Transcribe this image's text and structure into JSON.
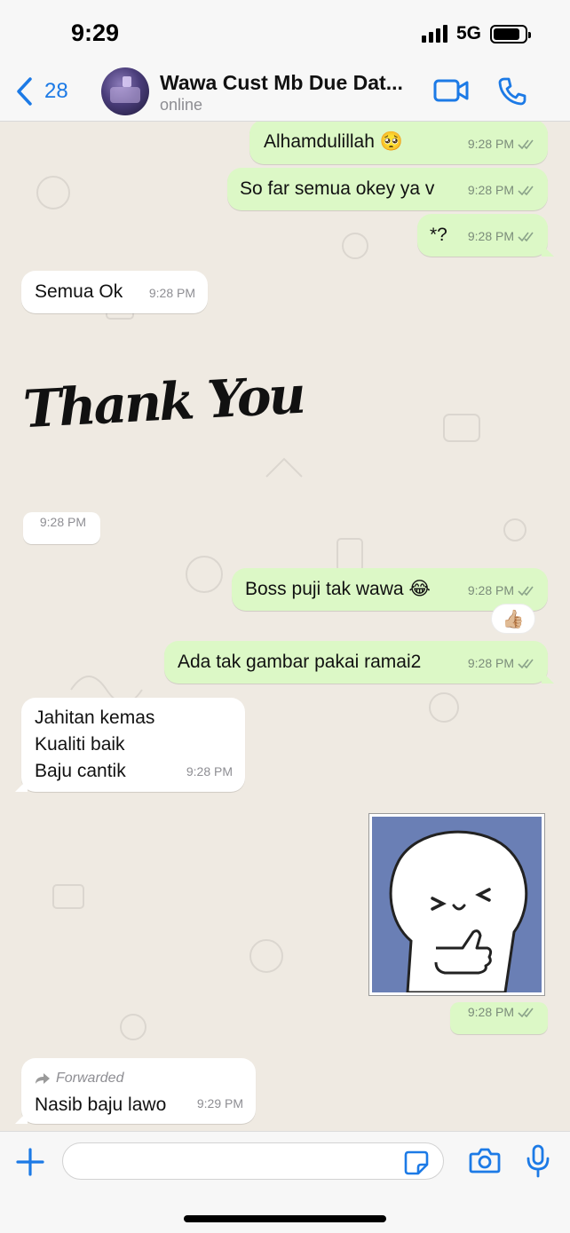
{
  "status_bar": {
    "time": "9:29",
    "network": "5G"
  },
  "header": {
    "back_count": "28",
    "contact_name": "Wawa Cust Mb Due Dat...",
    "contact_status": "online"
  },
  "messages": [
    {
      "dir": "out",
      "text": "Alhamdulillah 🥺",
      "time": "9:28 PM"
    },
    {
      "dir": "out",
      "text": "So far semua okey ya v",
      "time": "9:28 PM"
    },
    {
      "dir": "out",
      "text": "*?",
      "time": "9:28 PM"
    },
    {
      "dir": "in",
      "text": "Semua Ok",
      "time": "9:28 PM"
    },
    {
      "dir": "in",
      "type": "sticker",
      "text": "Thank You",
      "time": "9:28 PM"
    },
    {
      "dir": "out",
      "text": "Boss puji tak wawa 😂",
      "time": "9:28 PM",
      "reaction": "👍🏼"
    },
    {
      "dir": "out",
      "text": "Ada tak gambar pakai ramai2",
      "time": "9:28 PM"
    },
    {
      "dir": "in",
      "lines": [
        "Jahitan kemas",
        "Kualiti baik",
        "Baju cantik"
      ],
      "time": "9:28 PM"
    },
    {
      "dir": "out",
      "type": "sticker",
      "time": "9:28 PM"
    },
    {
      "dir": "in",
      "forwarded_label": "Forwarded",
      "text": "Nasib baju lawo",
      "time": "9:29 PM"
    }
  ],
  "input": {
    "placeholder": ""
  },
  "icons": {
    "back": "chevron-left-icon",
    "video": "video-camera-icon",
    "phone": "phone-icon",
    "plus": "plus-icon",
    "sticker": "sticker-icon",
    "camera": "camera-icon",
    "mic": "microphone-icon"
  },
  "colors": {
    "accent": "#1c7ae6",
    "outgoing_bubble": "#dcf8c6",
    "incoming_bubble": "#ffffff",
    "chat_background": "#efeae2"
  }
}
